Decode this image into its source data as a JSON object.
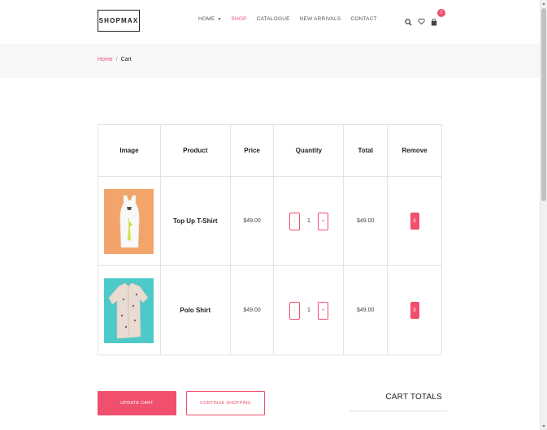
{
  "header": {
    "logo": "SHOPMAX",
    "nav": [
      {
        "label": "HOME",
        "has_dropdown": true,
        "active": false
      },
      {
        "label": "SHOP",
        "has_dropdown": false,
        "active": true
      },
      {
        "label": "CATALOGUE",
        "has_dropdown": false,
        "active": false
      },
      {
        "label": "NEW ARRIVALS",
        "has_dropdown": false,
        "active": false
      },
      {
        "label": "CONTACT",
        "has_dropdown": false,
        "active": false
      }
    ],
    "icons": [
      "search-icon",
      "heart-icon",
      "shopping-bag-icon"
    ],
    "cart_count": "2"
  },
  "breadcrumb": {
    "home": "Home",
    "separator": "/",
    "current": "Cart"
  },
  "cart_table": {
    "headers": [
      "Image",
      "Product",
      "Price",
      "Quantity",
      "Total",
      "Remove"
    ],
    "rows": [
      {
        "product": "Top Up T-Shirt",
        "price": "$49.00",
        "quantity": "1",
        "total": "$49.00",
        "minus": "-",
        "plus": "+",
        "remove": "X"
      },
      {
        "product": "Polo Shirt",
        "price": "$49.00",
        "quantity": "1",
        "total": "$49.00",
        "minus": "-",
        "plus": "+",
        "remove": "X"
      }
    ]
  },
  "actions": {
    "update_cart": "UPDATE CART",
    "continue_shopping": "CONTINUE SHOPPING"
  },
  "totals": {
    "title": "CART TOTALS"
  },
  "colors": {
    "accent": "#f0506e",
    "breadcrumb_bg": "#f6f7f9",
    "thumb1_bg": "#f3a46a",
    "thumb2_bg": "#4ec9c9"
  }
}
